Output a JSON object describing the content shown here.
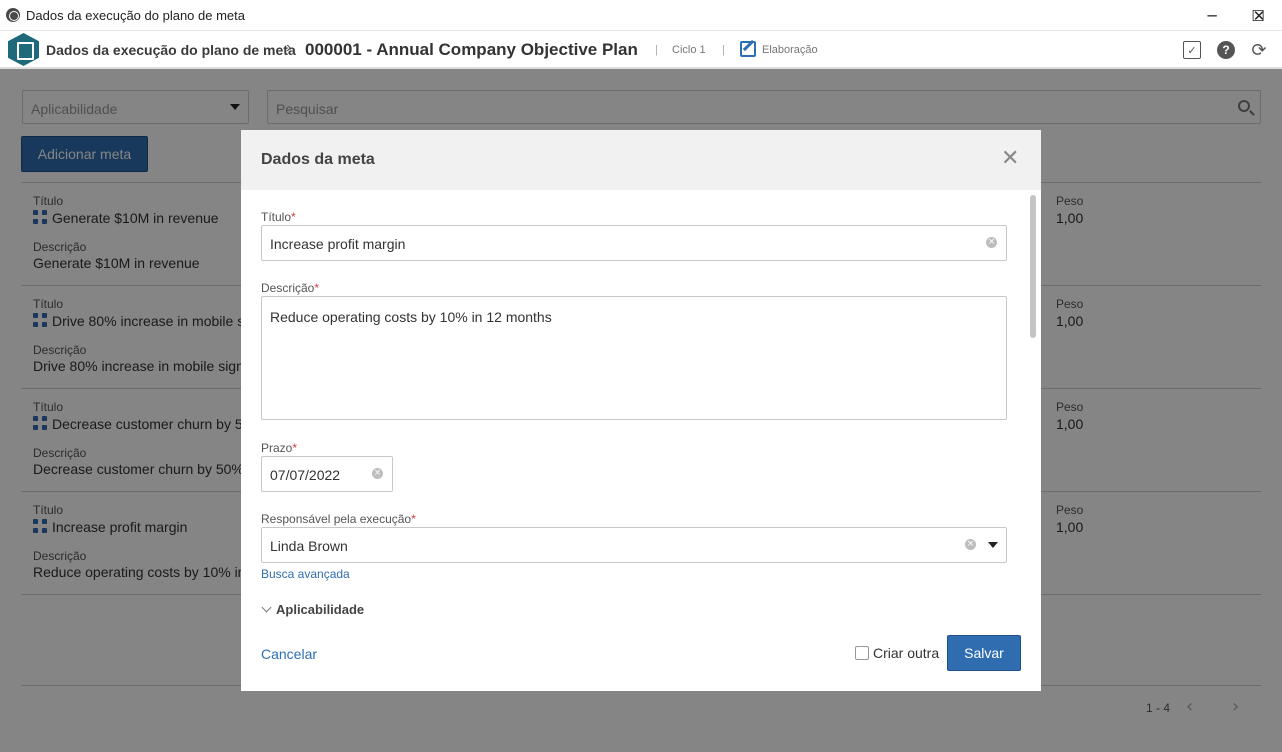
{
  "window": {
    "title": "Dados da execução do plano de meta",
    "minimize": "─",
    "maximize": "☐",
    "close": "✕"
  },
  "header": {
    "crumb_root": "Dados da execução do plano de meta",
    "crumb_separator": "›",
    "plan": "000001 - Annual Company Objective Plan",
    "divider": "|",
    "cycle": "Ciclo 1",
    "stage": "Elaboração",
    "check_icon": "✓",
    "help_icon": "?",
    "refresh_icon": "⟳"
  },
  "filters": {
    "applicability_placeholder": "Aplicabilidade",
    "search_placeholder": "Pesquisar"
  },
  "add_button": "Adicionar meta",
  "goals": [
    {
      "title_label": "Título",
      "title": "Generate $10M in revenue",
      "desc_label": "Descrição",
      "desc": "Generate $10M in revenue",
      "weight_label": "Peso",
      "weight": "1,00"
    },
    {
      "title_label": "Título",
      "title": "Drive 80% increase in mobile s",
      "desc_label": "Descrição",
      "desc": "Drive 80% increase in mobile sign",
      "weight_label": "Peso",
      "weight": "1,00"
    },
    {
      "title_label": "Título",
      "title": "Decrease customer churn by 5",
      "desc_label": "Descrição",
      "desc": "Decrease customer churn by 50%",
      "weight_label": "Peso",
      "weight": "1,00"
    },
    {
      "title_label": "Título",
      "title": "Increase profit margin",
      "desc_label": "Descrição",
      "desc": "Reduce operating costs by 10% in",
      "weight_label": "Peso",
      "weight": "1,00"
    }
  ],
  "pagination": {
    "range": "1 - 4",
    "prev": "‹",
    "next": "›"
  },
  "modal": {
    "title": "Dados da meta",
    "close_icon": "✕",
    "required_mark": "*",
    "title_label": "Título",
    "title_value": "Increase profit margin",
    "description_label": "Descrição",
    "description_value": "Reduce operating costs by 10% in 12 months",
    "deadline_label": "Prazo",
    "deadline_value": "07/07/2022",
    "responsible_label": "Responsável pela execução",
    "responsible_value": "Linda Brown",
    "advanced_search": "Busca avançada",
    "applicability_section": "Aplicabilidade",
    "cancel": "Cancelar",
    "create_another": "Criar outra",
    "create_another_checked": false,
    "save": "Salvar",
    "clear_icon": "×"
  },
  "colors": {
    "primary": "#2f6db0",
    "required": "#d23a3a",
    "brand_hex": "#1e6a7a"
  }
}
